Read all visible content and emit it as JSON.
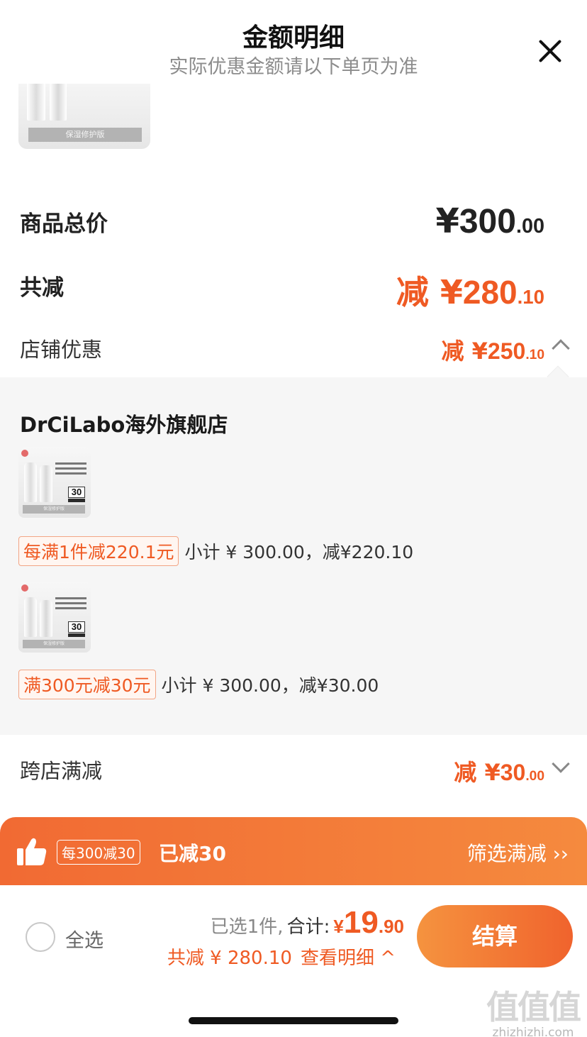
{
  "header": {
    "title": "金额明细",
    "subtitle": "实际优惠金额请以下单页为准"
  },
  "summary_rows": {
    "total": {
      "label": "商品总价",
      "prefix": "¥",
      "integer": "300",
      "cents": ".00"
    },
    "reduce": {
      "label": "共减",
      "prefix": "减 ¥",
      "integer": "280",
      "cents": ".10"
    },
    "shop_discount": {
      "label": "店铺优惠",
      "prefix": "减 ¥",
      "integer": "250",
      "cents": ".10"
    },
    "cross_store": {
      "label": "跨店满减",
      "prefix": "减 ¥",
      "integer": "30",
      "cents": ".00"
    }
  },
  "store": {
    "name": "DrCiLabo海外旗舰店",
    "promos": [
      {
        "tag": "每满1件减220.1元",
        "subtotal": "小计 ¥ 300.00，减¥220.10"
      },
      {
        "tag": "满300元减30元",
        "subtotal": "小计 ¥ 300.00，减¥30.00"
      }
    ]
  },
  "product_image": {
    "band_text": "保湿修护版",
    "spf": "30"
  },
  "banner": {
    "badge": "每300减30",
    "reduced": "已减30",
    "filter": "筛选满减 ››"
  },
  "bottom": {
    "select_all": "全选",
    "selected": "已选1件,",
    "total_label": "合计:",
    "total_prefix": "¥",
    "total_integer": "19",
    "total_cents": ".90",
    "reduce_text": "共减 ¥ 280.10",
    "view_detail": "查看明细 ^",
    "checkout": "结算"
  },
  "watermark": {
    "big": "值值值",
    "small": "zhizhizhi.com"
  },
  "colors": {
    "accent": "#ef5a23",
    "banner_start": "#f16a33",
    "banner_end": "#f58a3e",
    "panel_bg": "#f6f6f6"
  }
}
